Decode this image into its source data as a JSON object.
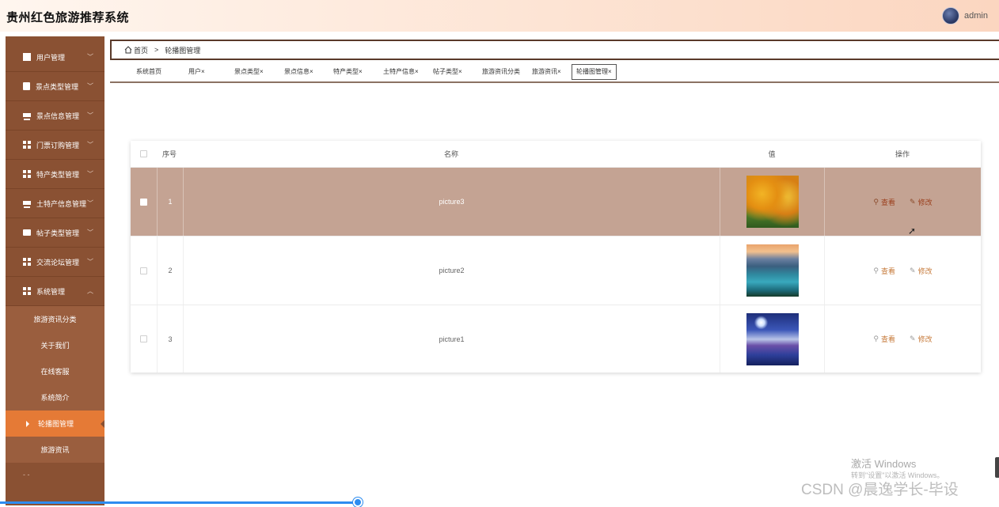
{
  "app": {
    "title": "贵州红色旅游推荐系统",
    "username": "admin"
  },
  "sidebar": {
    "items": [
      {
        "label": "用户管理",
        "icon": "user-icon",
        "chevron": "﹀"
      },
      {
        "label": "景点类型管理",
        "icon": "clipboard-icon",
        "chevron": "﹀"
      },
      {
        "label": "景点信息管理",
        "icon": "monitor-icon",
        "chevron": "﹀"
      },
      {
        "label": "门票订购管理",
        "icon": "grid-icon",
        "chevron": "﹀"
      },
      {
        "label": "特产类型管理",
        "icon": "grid-icon",
        "chevron": "﹀"
      },
      {
        "label": "土特产信息管理",
        "icon": "monitor-icon",
        "chevron": "﹀"
      },
      {
        "label": "帖子类型管理",
        "icon": "chat-icon",
        "chevron": "﹀"
      },
      {
        "label": "交流论坛管理",
        "icon": "grid-icon",
        "chevron": "﹀"
      },
      {
        "label": "系统管理",
        "icon": "grid-icon",
        "chevron": "︿"
      }
    ],
    "submenu": [
      {
        "label": "旅游资讯分类"
      },
      {
        "label": "关于我们"
      },
      {
        "label": "在线客服"
      },
      {
        "label": "系统简介"
      },
      {
        "label": "轮播图管理",
        "active": true
      },
      {
        "label": "旅游资讯"
      }
    ],
    "more": "- -"
  },
  "breadcrumb": {
    "home": "首页",
    "separator": ">",
    "current": "轮播图管理"
  },
  "tabs": [
    {
      "label": "系统首页"
    },
    {
      "label": "用户×"
    },
    {
      "label": "景点类型×"
    },
    {
      "label": "景点信息×"
    },
    {
      "label": "特产类型×"
    },
    {
      "label": "土特产信息×"
    },
    {
      "label": "帖子类型×"
    },
    {
      "label": "旅游资讯分类"
    },
    {
      "label": "旅游资讯×"
    },
    {
      "label": "轮播图管理×",
      "active": true
    }
  ],
  "table": {
    "headers": {
      "index": "序号",
      "name": "名称",
      "value": "值",
      "actions": "操作"
    },
    "rows": [
      {
        "index": "1",
        "name": "picture3",
        "image": "autumn-trees-thumbnail",
        "highlighted": true
      },
      {
        "index": "2",
        "name": "picture2",
        "image": "mountain-lake-thumbnail",
        "highlighted": false
      },
      {
        "index": "3",
        "name": "picture1",
        "image": "night-lake-thumbnail",
        "highlighted": false
      }
    ],
    "actions": {
      "view": "查看",
      "edit": "修改"
    }
  },
  "watermark": {
    "activate_title": "激活 Windows",
    "activate_sub": "转到\"设置\"以激活 Windows。",
    "csdn": "CSDN @晨逸学长-毕设"
  },
  "colors": {
    "sidebar": "#8a5133",
    "active_menu": "#e57a36",
    "row_highlight": "#c4a393",
    "action_link": "#c67a3a",
    "progress": "#2d8cf0"
  }
}
